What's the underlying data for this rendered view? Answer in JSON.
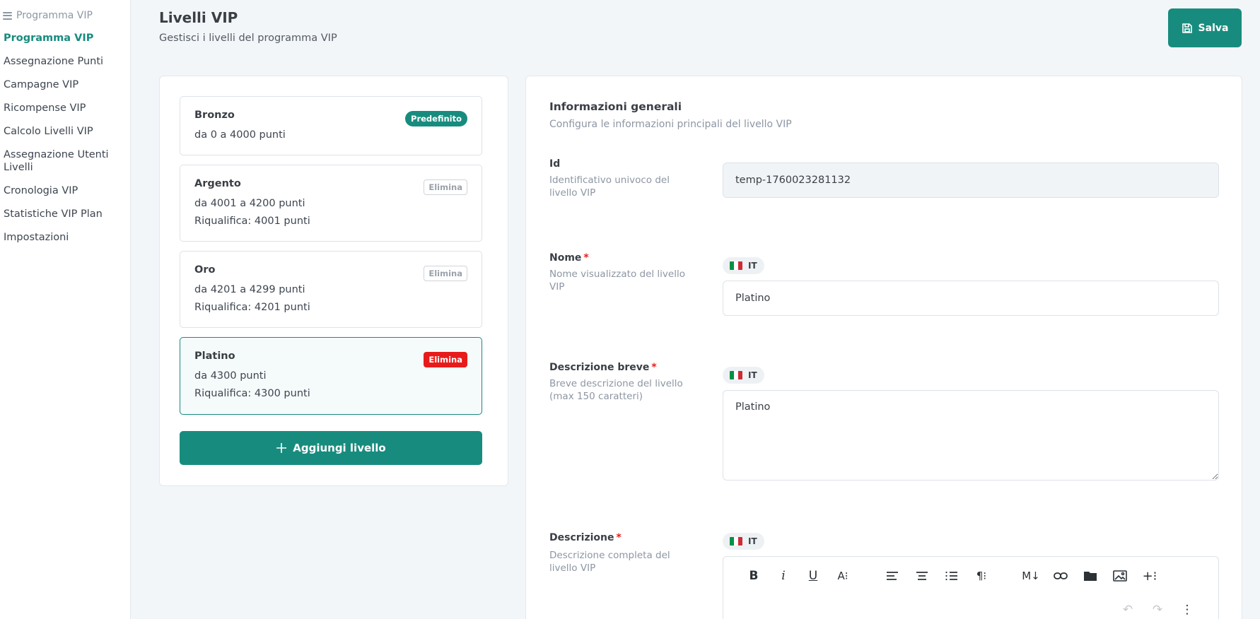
{
  "sidebar": {
    "header": "Programma VIP",
    "items": [
      {
        "label": "Programma VIP",
        "active": true
      },
      {
        "label": "Assegnazione Punti"
      },
      {
        "label": "Campagne VIP"
      },
      {
        "label": "Ricompense VIP"
      },
      {
        "label": "Calcolo Livelli VIP"
      },
      {
        "label": "Assegnazione Utenti Livelli"
      },
      {
        "label": "Cronologia VIP"
      },
      {
        "label": "Statistiche VIP Plan"
      },
      {
        "label": "Impostazioni"
      }
    ]
  },
  "header": {
    "title": "Livelli VIP",
    "subtitle": "Gestisci i livelli del programma VIP",
    "save_label": "Salva"
  },
  "levels": [
    {
      "name": "Bronzo",
      "range": "da 0 a 4000 punti",
      "requalify": "",
      "badge": "Predefinito"
    },
    {
      "name": "Argento",
      "range": "da 4001 a 4200 punti",
      "requalify": "Riqualifica: 4001 punti",
      "badge": "Elimina"
    },
    {
      "name": "Oro",
      "range": "da 4201 a 4299 punti",
      "requalify": "Riqualifica: 4201 punti",
      "badge": "Elimina"
    },
    {
      "name": "Platino",
      "range": "da 4300 punti",
      "requalify": "Riqualifica: 4300 punti",
      "badge": "Elimina",
      "selected": true
    }
  ],
  "add_level_label": "Aggiungi livello",
  "form": {
    "section_title": "Informazioni generali",
    "section_subtitle": "Configura le informazioni principali del livello VIP",
    "id": {
      "label": "Id",
      "description": "Identificativo univoco del livello VIP",
      "value": "temp-1760023281132"
    },
    "name": {
      "label": "Nome",
      "required": "*",
      "description": "Nome visualizzato del livello VIP",
      "lang": "IT",
      "value": "Platino"
    },
    "short_description": {
      "label": "Descrizione breve",
      "required": "*",
      "description": "Breve descrizione del livello (max 150 caratteri)",
      "lang": "IT",
      "value": "Platino"
    },
    "description": {
      "label": "Descrizione",
      "required": "*",
      "description": "Descrizione completa del livello VIP",
      "lang": "IT"
    }
  },
  "colors": {
    "accent": "#178c7e",
    "danger": "#e81b1b",
    "flag_green": "#009246",
    "flag_white": "#ffffff",
    "flag_red": "#ce2b37"
  },
  "icons": {
    "menu": "hamburger-icon",
    "save": "floppy-disk-icon",
    "add": "plus-icon"
  }
}
